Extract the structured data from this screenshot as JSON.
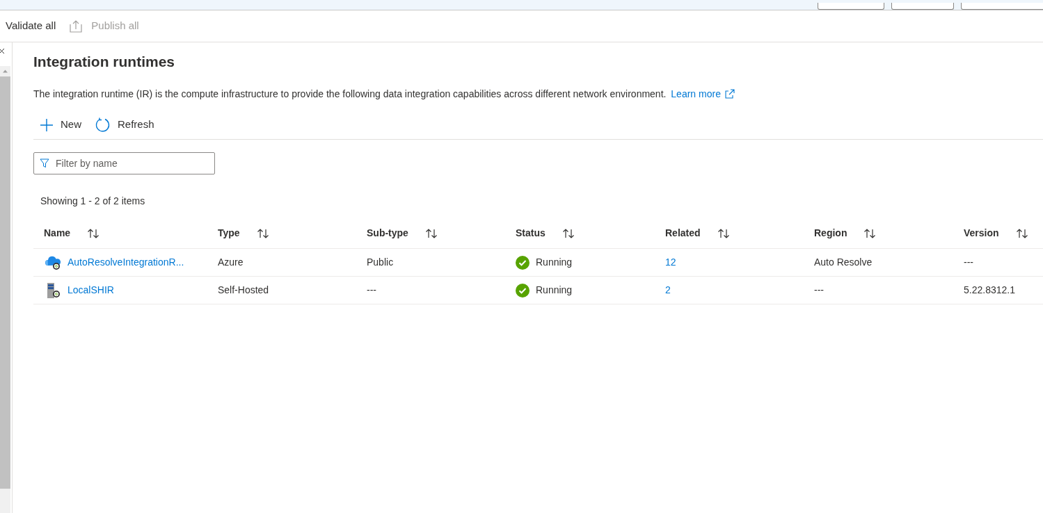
{
  "toolbar": {
    "items": [
      {
        "label": "Validate all",
        "disabled": false,
        "kind": "plain"
      },
      {
        "label": "Publish all",
        "disabled": true,
        "kind": "publish"
      }
    ]
  },
  "page": {
    "title": "Integration runtimes",
    "description": "The integration runtime (IR) is the compute infrastructure to provide the following data integration capabilities across different network environment.",
    "learn_more": "Learn more"
  },
  "actions": [
    {
      "label": "New",
      "kind": "plus"
    },
    {
      "label": "Refresh",
      "kind": "refresh"
    }
  ],
  "filter": {
    "placeholder": "Filter by name"
  },
  "summary": "Showing 1 - 2 of 2 items",
  "table": {
    "columns": [
      "Name",
      "Type",
      "Sub-type",
      "Status",
      "Related",
      "Region",
      "Version"
    ],
    "rows": [
      {
        "kind": "cloud",
        "name": "AutoResolveIntegrationR...",
        "type": "Azure",
        "subtype": "Public",
        "status": {
          "text": "Running",
          "kind": "ok"
        },
        "related": "12",
        "region": "Auto Resolve",
        "version": "---"
      },
      {
        "kind": "server",
        "name": "LocalSHIR",
        "type": "Self-Hosted",
        "subtype": "---",
        "status": {
          "text": "Running",
          "kind": "ok"
        },
        "related": "2",
        "region": "---",
        "version": "5.22.8312.1"
      }
    ]
  }
}
